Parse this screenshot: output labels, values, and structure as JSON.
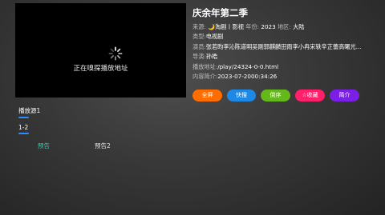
{
  "player": {
    "status_text": "正在嗅探播放地址"
  },
  "info": {
    "title": "庆余年第二季",
    "source_label": "来源:",
    "source_value": "🌙淘剧丨影视",
    "year_label": "年份:",
    "year_value": "2023",
    "region_label": "地区:",
    "region_value": "大陆",
    "type_label": "类型:",
    "type_value": "电视剧",
    "actors_label": "演员:",
    "actors_value": "张若昀李沁陈道明吴刚郭麒麟田雨李小冉宋轶辛芷蕾高曙光...",
    "director_label": "导演:",
    "director_value": "孙皓",
    "play_url_label": "播放地址:",
    "play_url_value": "/play/24324-0-0.html",
    "intro_label": "内容简介:",
    "intro_value": "2023-07-2000:34:26"
  },
  "buttons": [
    {
      "label": "全屏",
      "color": "#ff6d00"
    },
    {
      "label": "快搜",
      "color": "#1e88e5"
    },
    {
      "label": "倒序",
      "color": "#64b81c"
    },
    {
      "label": "☆收藏",
      "color": "#ff1f6a"
    },
    {
      "label": "简介",
      "color": "#7c1fe6"
    }
  ],
  "source_tab": "播放源1",
  "group_tab": "1-2",
  "episodes": [
    {
      "label": "预告",
      "color": "#26d7b0"
    },
    {
      "label": "预告2",
      "color": "#e8e8e8"
    }
  ],
  "accent_color": "#2f8cff"
}
